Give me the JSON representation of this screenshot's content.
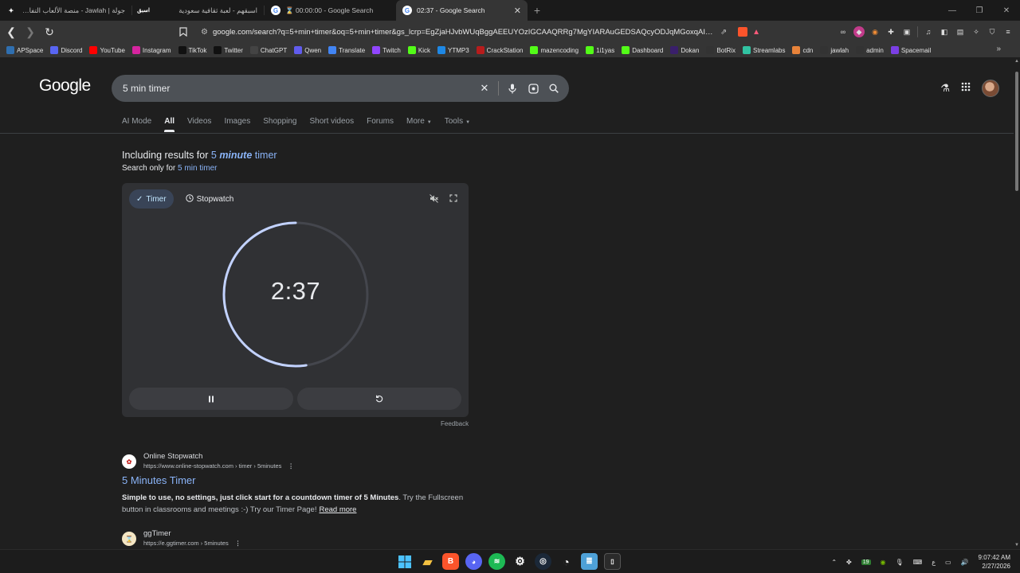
{
  "browser": {
    "tabs": [
      {
        "title": "جولة | Jawlah - منصة الألعاب التفاعلية",
        "icon": "jawlah-icon",
        "active": false
      },
      {
        "title": "اسبقهم - لعبة ثقافية سعودية",
        "icon": "asbaqhum-icon",
        "active": false
      },
      {
        "title": "⌛ 00:00:00 - Google Search",
        "icon": "google-icon",
        "active": false
      },
      {
        "title": "02:37 - Google Search",
        "icon": "google-icon",
        "active": true
      }
    ],
    "new_tab": "+",
    "close_glyph": "✕",
    "url": "google.com/search?q=5+min+timer&oq=5+min+timer&gs_lcrp=EgZjaHJvbWUqBggAEEUYOzIGCAAQRRg7MgYIARAuGEDSAQcyODJqMGoxqAIAsA...",
    "shield_badge": "1"
  },
  "bookmarks": [
    {
      "label": "APSpace",
      "icon": "apspace-icon",
      "color": "#2f6fb0"
    },
    {
      "label": "Discord",
      "icon": "discord-icon",
      "color": "#5865f2"
    },
    {
      "label": "YouTube",
      "icon": "youtube-icon",
      "color": "#ff0000"
    },
    {
      "label": "Instagram",
      "icon": "instagram-icon",
      "color": "#d6249f"
    },
    {
      "label": "TikTok",
      "icon": "tiktok-icon",
      "color": "#111111"
    },
    {
      "label": "Twitter",
      "icon": "x-icon",
      "color": "#111111"
    },
    {
      "label": "ChatGPT",
      "icon": "chatgpt-icon",
      "color": "#444444"
    },
    {
      "label": "Qwen",
      "icon": "qwen-icon",
      "color": "#615ced"
    },
    {
      "label": "Translate",
      "icon": "translate-icon",
      "color": "#4285f4"
    },
    {
      "label": "Twitch",
      "icon": "twitch-icon",
      "color": "#9146ff"
    },
    {
      "label": "Kick",
      "icon": "kick-icon",
      "color": "#53fc18"
    },
    {
      "label": "YTMP3",
      "icon": "ytmp3-icon",
      "color": "#1e88e5"
    },
    {
      "label": "CrackStation",
      "icon": "crackstation-icon",
      "color": "#b71c1c"
    },
    {
      "label": "mazencoding",
      "icon": "kick-icon",
      "color": "#53fc18"
    },
    {
      "label": "1i1yas",
      "icon": "kick-icon",
      "color": "#53fc18"
    },
    {
      "label": "Dashboard",
      "icon": "kick-icon",
      "color": "#53fc18"
    },
    {
      "label": "Dokan",
      "icon": "dokan-icon",
      "color": "#3a1f6b"
    },
    {
      "label": "BotRix",
      "icon": "botrix-icon",
      "color": "#333333"
    },
    {
      "label": "Streamlabs",
      "icon": "streamlabs-icon",
      "color": "#31c3a2"
    },
    {
      "label": "cdn",
      "icon": "cdn-icon",
      "color": "#e8833a"
    },
    {
      "label": "jawlah",
      "icon": "jawlah-icon",
      "color": "#333333"
    },
    {
      "label": "admin",
      "icon": "jawlah-icon",
      "color": "#333333"
    },
    {
      "label": "Spacemail",
      "icon": "spacemail-icon",
      "color": "#7b3fe4"
    }
  ],
  "bookmarks_more": "»",
  "google": {
    "logo": "Google",
    "query": "5 min timer",
    "search_tabs": [
      {
        "label": "AI Mode",
        "selected": false,
        "dropdown": false
      },
      {
        "label": "All",
        "selected": true,
        "dropdown": false
      },
      {
        "label": "Videos",
        "selected": false,
        "dropdown": false
      },
      {
        "label": "Images",
        "selected": false,
        "dropdown": false
      },
      {
        "label": "Shopping",
        "selected": false,
        "dropdown": false
      },
      {
        "label": "Short videos",
        "selected": false,
        "dropdown": false
      },
      {
        "label": "Forums",
        "selected": false,
        "dropdown": false
      },
      {
        "label": "More",
        "selected": false,
        "dropdown": true
      },
      {
        "label": "Tools",
        "selected": false,
        "dropdown": true
      }
    ],
    "including_prefix": "Including results for",
    "including_num": "5",
    "including_word": "minute",
    "including_rest": "timer",
    "only_prefix": "Search only for",
    "only_query": "5 min timer"
  },
  "timer": {
    "mode_timer": "Timer",
    "mode_stopwatch": "Stopwatch",
    "display": "2:37",
    "total_seconds": 300,
    "remaining_seconds": 157,
    "ring_color": "#c2d2ff",
    "track_color": "#44464d",
    "feedback": "Feedback"
  },
  "results": [
    {
      "site": "Online Stopwatch",
      "url": "https://www.online-stopwatch.com › timer › 5minutes",
      "title": "5 Minutes Timer",
      "snippet_bold": "Simple to use, no settings, just click start for a countdown timer of 5 Minutes",
      "snippet_rest": ". Try the Fullscreen button in classrooms and meetings :-) Try our Timer Page!",
      "read_more": "Read more"
    },
    {
      "site": "ggTimer",
      "url": "https://e.ggtimer.com › 5minutes"
    }
  ],
  "taskbar": {
    "time": "9:07:42 AM",
    "date": "2/27/2026",
    "lang": "ع",
    "badge": "19"
  }
}
